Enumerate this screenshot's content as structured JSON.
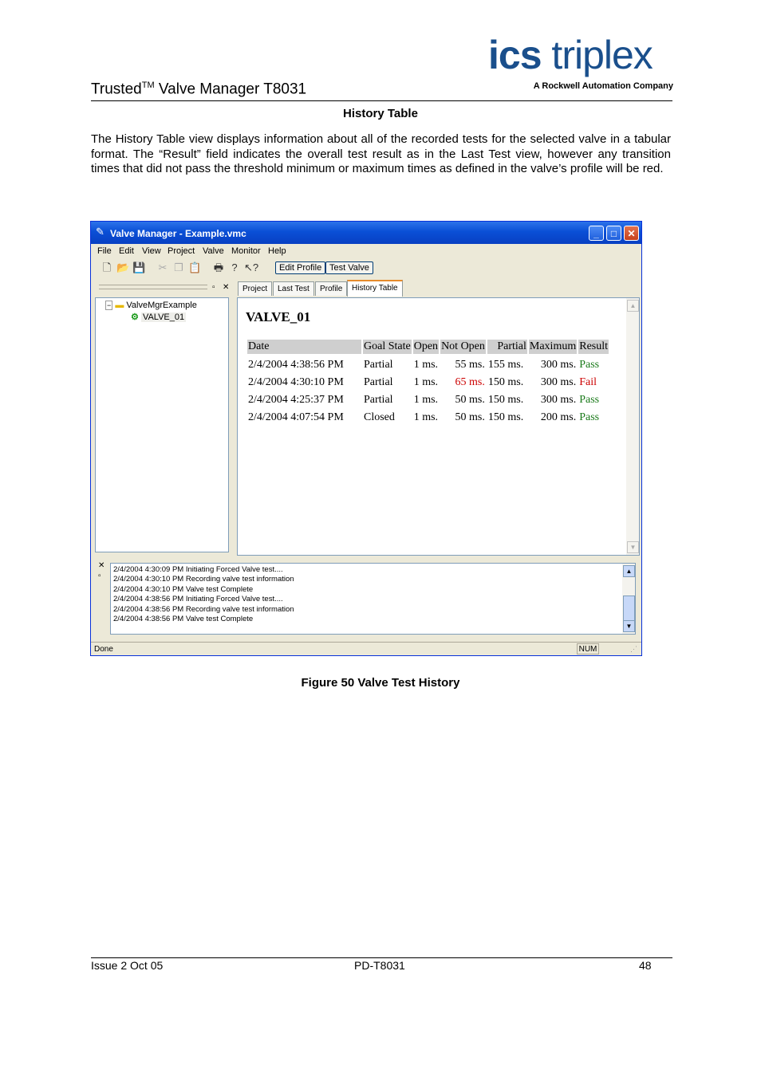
{
  "header": {
    "title_pre": "Trusted",
    "title_sup": "TM",
    "title_post": " Valve Manager T8031",
    "logo_bold": "ics",
    "logo_light": "triplex",
    "logo_sub": "A Rockwell Automation Company"
  },
  "section_heading": "History Table",
  "intro": "The History Table view displays information about all of the recorded tests for the selected valve in a tabular format.  The “Result” field indicates the overall test result as in the Last Test view, however any transition times that did not pass the threshold minimum or maximum times as defined in the valve’s profile will be red.",
  "window": {
    "title": "Valve Manager - Example.vmc",
    "menu": [
      "File",
      "Edit",
      "View",
      "Project",
      "Valve",
      "Monitor",
      "Help"
    ],
    "toolbar": {
      "edit_profile": "Edit Profile",
      "test_valve": "Test Valve"
    },
    "tree": {
      "root": "ValveMgrExample",
      "child": "VALVE_01"
    },
    "tabs": [
      "Project",
      "Last Test",
      "Profile",
      "History Table"
    ],
    "valve_title": "VALVE_01",
    "table": {
      "headers": [
        "Date",
        "Goal State",
        "Open",
        "Not Open",
        "Partial",
        "Maximum",
        "Result"
      ],
      "rows": [
        [
          "2/4/2004 4:38:56 PM",
          "Partial",
          "1 ms.",
          "55 ms.",
          "155 ms.",
          "300 ms.",
          "Pass"
        ],
        [
          "2/4/2004 4:30:10 PM",
          "Partial",
          "1 ms.",
          "65 ms.",
          "150 ms.",
          "300 ms.",
          "Fail"
        ],
        [
          "2/4/2004 4:25:37 PM",
          "Partial",
          "1 ms.",
          "50 ms.",
          "150 ms.",
          "300 ms.",
          "Pass"
        ],
        [
          "2/4/2004 4:07:54 PM",
          "Closed",
          "1 ms.",
          "50 ms.",
          "150 ms.",
          "200 ms.",
          "Pass"
        ]
      ]
    },
    "log": [
      "2/4/2004 4:30:09 PM Initiating Forced Valve test....",
      "2/4/2004 4:30:10 PM Recording valve test information",
      "2/4/2004 4:30:10 PM Valve test Complete",
      "2/4/2004 4:38:56 PM Initiating Forced Valve test....",
      "2/4/2004 4:38:56 PM Recording valve test information",
      "2/4/2004 4:38:56 PM Valve test Complete"
    ],
    "status": "Done",
    "num_indicator": "NUM",
    "colors": {
      "pass": "#1a7a1a",
      "fail": "#cc0000",
      "titlebar": "#0a4fd6"
    }
  },
  "caption": "Figure 50 Valve Test History",
  "footer": {
    "left": "Issue 2 Oct 05",
    "center": "PD-T8031",
    "right": "48"
  }
}
